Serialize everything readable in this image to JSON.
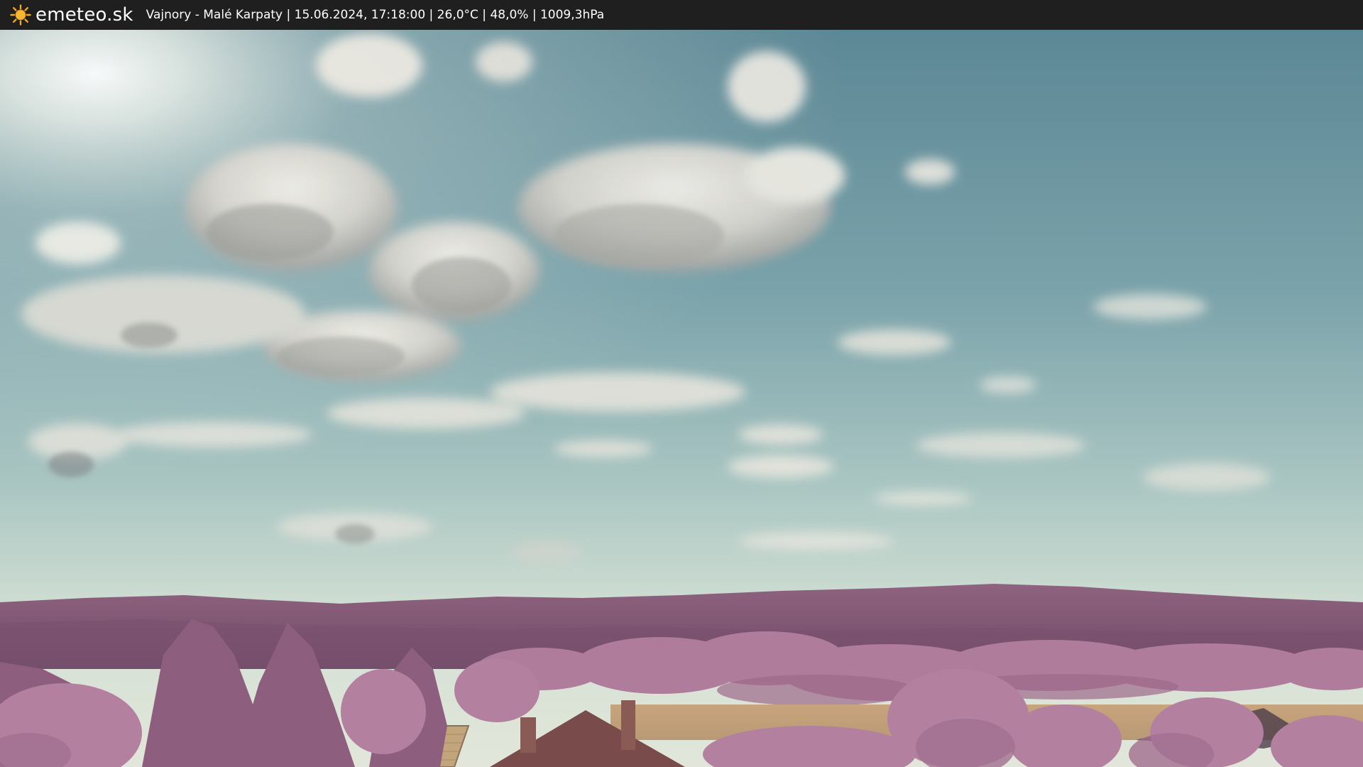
{
  "header": {
    "logo_icon": "sun-icon",
    "brand": "emeteo.sk",
    "caption": "Vajnory - Malé Karpaty | 15.06.2024, 17:18:00 | 26,0°C | 48,0% | 1009,3hPa"
  },
  "colors": {
    "bar_background": "#1f1f1f",
    "sun": "#f5a623",
    "sky_top": "#5f8a97",
    "sky_horizon": "#d9e4d6",
    "hills": "#8a5a78",
    "foliage": "#b07a9a",
    "field": "#c8aa7e"
  }
}
